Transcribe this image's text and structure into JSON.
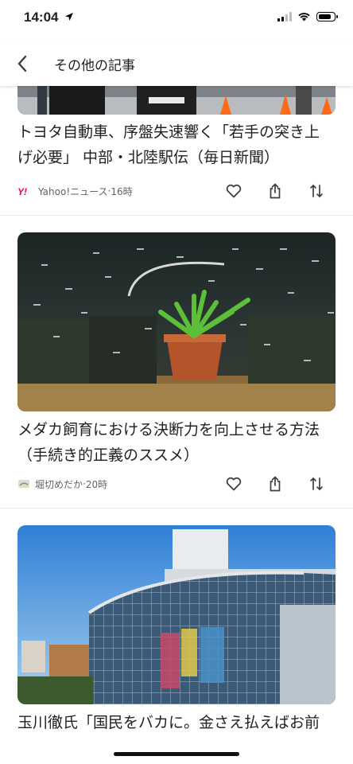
{
  "status_bar": {
    "time": "14:04",
    "battery_level": 0.85
  },
  "header": {
    "title": "その他の記事"
  },
  "articles": [
    {
      "title_lines": [
        "トヨタ自動車、序盤失速響く「若手の突き上",
        "げ必要」 中部・北陸駅伝（毎日新聞）"
      ],
      "source": "Yahoo!ニュース",
      "time": "16時"
    },
    {
      "title_lines": [
        "メダカ飼育における決断力を向上させる方法",
        "（手続き的正義のススメ）"
      ],
      "source": "堀切めだか",
      "time": "20時"
    },
    {
      "title_lines": [
        "玉川徹氏「国民をバカに。金さえ払えばお前"
      ]
    }
  ],
  "separator": " · ",
  "colors": {
    "yahoo_logo": "#ff0033",
    "text": "#202124",
    "meta": "#5f6368",
    "divider": "#e6e6e6"
  }
}
